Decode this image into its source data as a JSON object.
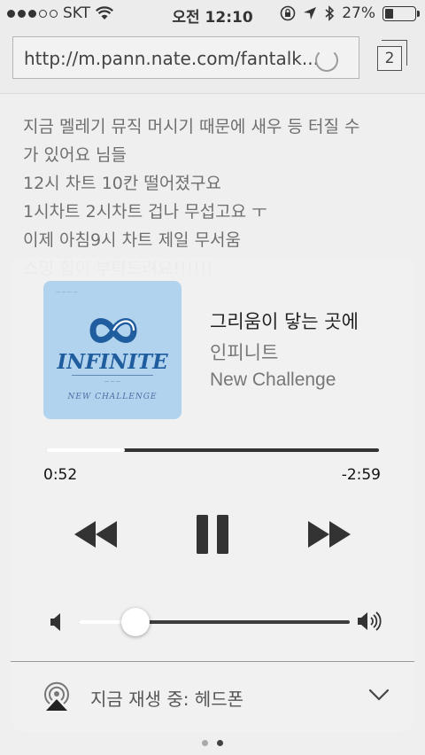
{
  "status_bar": {
    "carrier": "SKT",
    "signal_bars_filled": 3,
    "signal_bars_total": 5,
    "time": "오전 12:10",
    "battery_percent": "27%",
    "battery_level": 0.27
  },
  "browser": {
    "url": "http://m.pann.nate.com/fantalk...",
    "tab_count": "2",
    "article_lines": [
      "지금 멜레기 뮤직 머시기 때문에 새우 등 터질 수",
      "가 있어요 님들",
      "12시 차트 10칸 떨어졌구요",
      "1시차트 2시차트 겁나 무섭고요 ㅜ",
      "이제 아침9시 차트 제일 무서움",
      "스밍 힘이 부탁드려요!!!!!!"
    ],
    "page_count": 2,
    "active_page": 2
  },
  "now_playing": {
    "album_art": {
      "band_logo": "INFINITE",
      "album_text": "NEW CHALLENGE"
    },
    "title": "그리움이 닿는 곳에",
    "artist": "인피니트",
    "album": "New Challenge",
    "elapsed": "0:52",
    "remaining": "-2:59",
    "progress": 0.236,
    "volume": 0.21,
    "output_label": "지금 재생 중: 헤드폰"
  },
  "icons": {
    "rewind": "rewind-icon",
    "pause": "pause-icon",
    "forward": "fast-forward-icon",
    "volume_low": "speaker-low-icon",
    "volume_high": "speaker-high-icon",
    "airplay": "airplay-icon",
    "chevron": "chevron-down-icon"
  },
  "colors": {
    "art_background": "#b2d3ee",
    "logo_blue": "#1f5d9f"
  }
}
